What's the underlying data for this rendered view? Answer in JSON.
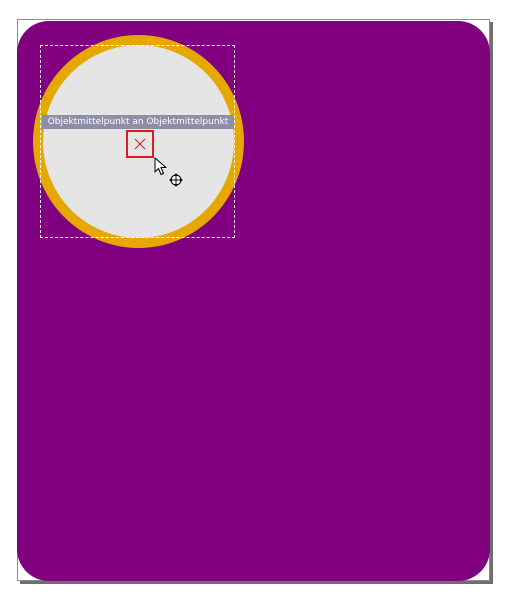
{
  "snap": {
    "label": "Objektmittelpunkt an Objektmittelpunkt"
  },
  "colors": {
    "purple_fill": "#800080",
    "circle_fill": "#e5e5e5",
    "circle_outline": "#e6a800",
    "snap_label_bg": "#8e8ea8",
    "snap_marker": "#d71f1f"
  },
  "icons": {
    "snap_marker": "center-snap-x-icon",
    "pointer": "arrow-cursor-icon",
    "move": "move-arrows-icon"
  }
}
